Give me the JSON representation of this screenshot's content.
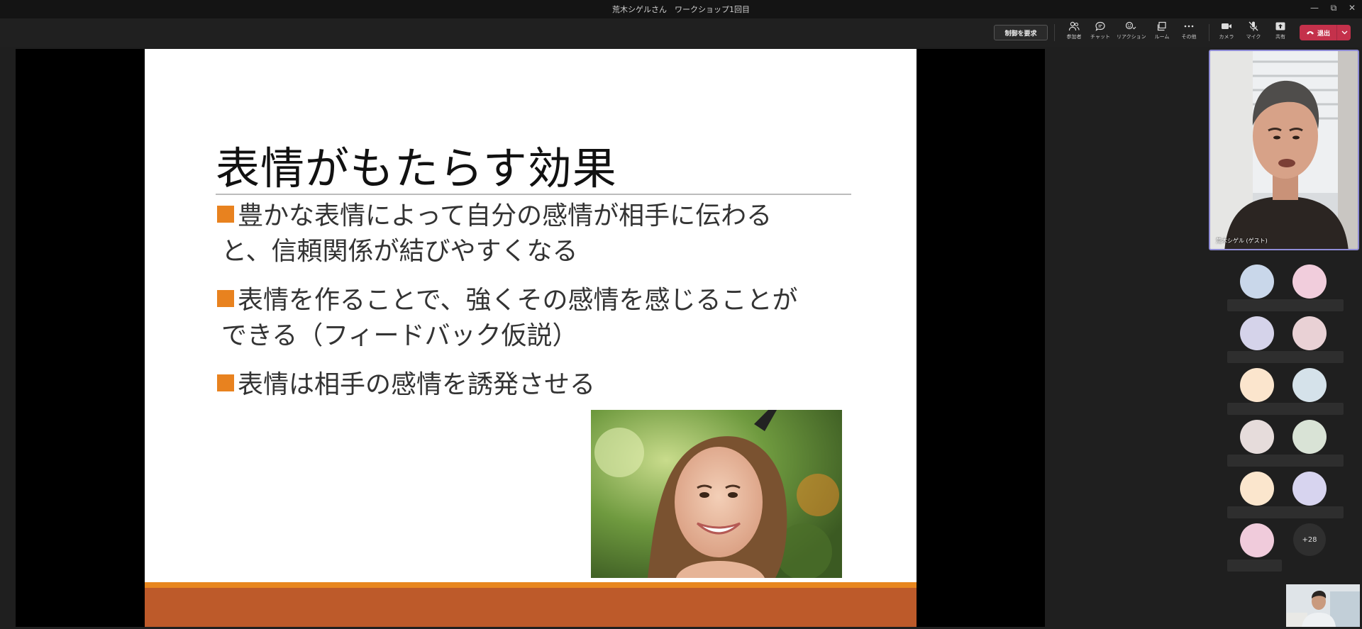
{
  "window": {
    "title": "荒木シゲルさん　ワークショップ1回目",
    "controls": [
      "minimize-icon",
      "restore-icon",
      "close-icon"
    ]
  },
  "toolbar": {
    "request_control_label": "制御を要求",
    "buttons": [
      {
        "icon": "people-icon",
        "label": "参加者"
      },
      {
        "icon": "chat-icon",
        "label": "チャット"
      },
      {
        "icon": "reaction-icon",
        "label": "リアクション"
      },
      {
        "icon": "rooms-icon",
        "label": "ルーム"
      },
      {
        "icon": "more-icon",
        "label": "その他"
      },
      {
        "icon": "camera-icon",
        "label": "カメラ"
      },
      {
        "icon": "mic-off-icon",
        "label": "マイク"
      },
      {
        "icon": "share-icon",
        "label": "共有"
      }
    ],
    "leave_label": "退出",
    "leave_color": "#c4314b"
  },
  "slide": {
    "title": "表情がもたらす効果",
    "bullets": [
      {
        "line1": "豊かな表情によって自分の感情が相手に伝わる",
        "line2": "と、信頼関係が結びやすくなる"
      },
      {
        "line1": "表情を作ることで、強くその感情を感じることが",
        "line2": "できる（フィードバック仮説）"
      },
      {
        "line1": "表情は相手の感情を誘発させる",
        "line2": ""
      }
    ],
    "bullet_color": "#e8821f",
    "footer_color": "#bd5a2a"
  },
  "participants": {
    "speaker_name": "荒木シゲル (ゲスト)",
    "avatar_colors": [
      "#c9d7ea",
      "#f1cddc",
      "#d5d3ea",
      "#e9d1d5",
      "#fbe5cd",
      "#d5e2ea",
      "#e6dcdb",
      "#d9e3d6",
      "#fbe6cd",
      "#d7d4ef",
      "#f0cbdb"
    ],
    "more_count": "+28"
  }
}
